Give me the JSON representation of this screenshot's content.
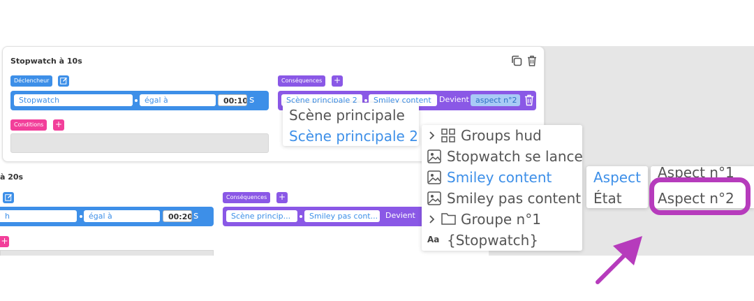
{
  "rule1": {
    "title": "Stopwatch à 10s",
    "trigger_label": "Déclencheur",
    "trigger": {
      "object": "Stopwatch",
      "operator": "égal à",
      "value": "00:10",
      "unit": "s"
    },
    "consequences_label": "Conséquences",
    "consequence": {
      "scene": "Scène principale 2",
      "object": "Smiley content",
      "verb": "Devient",
      "aspect": "aspect n°2"
    },
    "conditions_label": "Conditions",
    "add": "+"
  },
  "rule2": {
    "title_fragment": "à 20s",
    "trigger": {
      "object_fragment": "h",
      "operator": "égal à",
      "value": "00:20",
      "unit": "s"
    },
    "consequences_label": "Conséquences",
    "consequence": {
      "scene": "Scène princip...",
      "object": "Smiley pas cont...",
      "verb": "Devient"
    },
    "add": "+"
  },
  "scene_menu": {
    "items": [
      "Scène principale",
      "Scène principale 2"
    ],
    "selected": 1
  },
  "object_menu": {
    "items": [
      "Groups hud",
      "Stopwatch se lance",
      "Smiley content",
      "Smiley pas content",
      "Groupe n°1",
      "{Stopwatch}"
    ],
    "icons": [
      "grid-icon",
      "image-icon",
      "image-icon",
      "image-icon",
      "folder-icon",
      "text-icon"
    ],
    "selected": 2,
    "text_icon_glyph": "Aa"
  },
  "property_menu": {
    "items": [
      "Aspect",
      "État"
    ],
    "selected": 0
  },
  "aspect_menu": {
    "items": [
      "Aspect n°1",
      "Aspect n°2"
    ],
    "highlighted": 1
  },
  "colors": {
    "blue": "#3d8fe8",
    "purple": "#8a58e6",
    "pink": "#f23f9a",
    "annotation": "#b63bbc"
  }
}
